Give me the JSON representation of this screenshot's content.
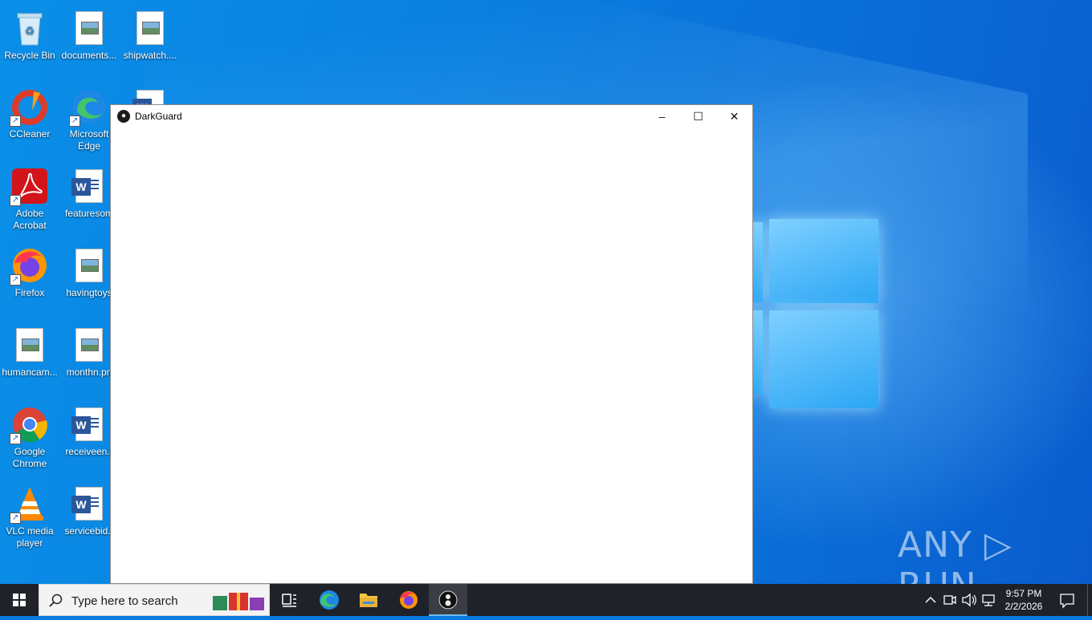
{
  "desktop": {
    "icons": [
      {
        "label": "Recycle Bin"
      },
      {
        "label": "documents..."
      },
      {
        "label": "shipwatch...."
      },
      {
        "label": "CCleaner"
      },
      {
        "label": "Microsoft Edge"
      },
      {
        "label": "Adobe Acrobat"
      },
      {
        "label": "featuresom"
      },
      {
        "label": "Firefox"
      },
      {
        "label": "havingtoys"
      },
      {
        "label": "humancam..."
      },
      {
        "label": "monthn.pn"
      },
      {
        "label": "Google Chrome"
      },
      {
        "label": "receiveen.r"
      },
      {
        "label": "VLC media player"
      },
      {
        "label": "servicebid.r"
      }
    ],
    "watermark": "ANY ▷ RUN"
  },
  "window": {
    "title": "DarkGuard",
    "minimize": "–",
    "maximize": "☐",
    "close": "✕"
  },
  "taskbar": {
    "search_placeholder": "Type here to search",
    "clock_time": "9:57 PM",
    "clock_date": "2/2/2026"
  },
  "colors": {
    "taskbar": "#1f2229",
    "desktop": "#0a7ae0",
    "window_bg": "#ffffff"
  }
}
